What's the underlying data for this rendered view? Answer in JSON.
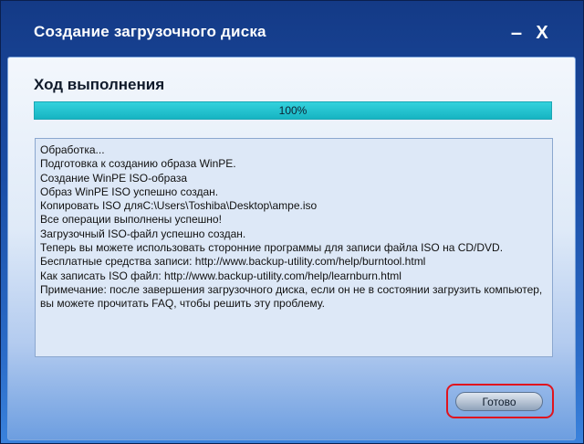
{
  "window": {
    "title": "Создание загрузочного диска",
    "minimize_glyph": "–",
    "close_glyph": "X"
  },
  "progress": {
    "heading": "Ход выполнения",
    "percent_label": "100%",
    "percent_value": 100,
    "fill_color": "#1fbfcc"
  },
  "log": {
    "lines": [
      "Обработка...",
      "Подготовка к созданию образа WinPE.",
      "Создание WinPE ISO-образа",
      "Образ WinPE ISO успешно создан.",
      "Копировать ISO дляC:\\Users\\Toshiba\\Desktop\\ampe.iso",
      "Все операции выполнены успешно!",
      "Загрузочный ISO-файл успешно создан.",
      "Теперь вы можете использовать сторонние программы для записи файла ISO на CD/DVD.",
      "Бесплатные средства записи: http://www.backup-utility.com/help/burntool.html",
      "Как записать ISO файл: http://www.backup-utility.com/help/learnburn.html",
      "Примечание: после завершения загрузочного диска, если он не в состоянии загрузить компьютер, вы можете прочитать FAQ, чтобы решить эту проблему."
    ]
  },
  "actions": {
    "done_label": "Готово",
    "highlight_color": "#e0141e"
  }
}
